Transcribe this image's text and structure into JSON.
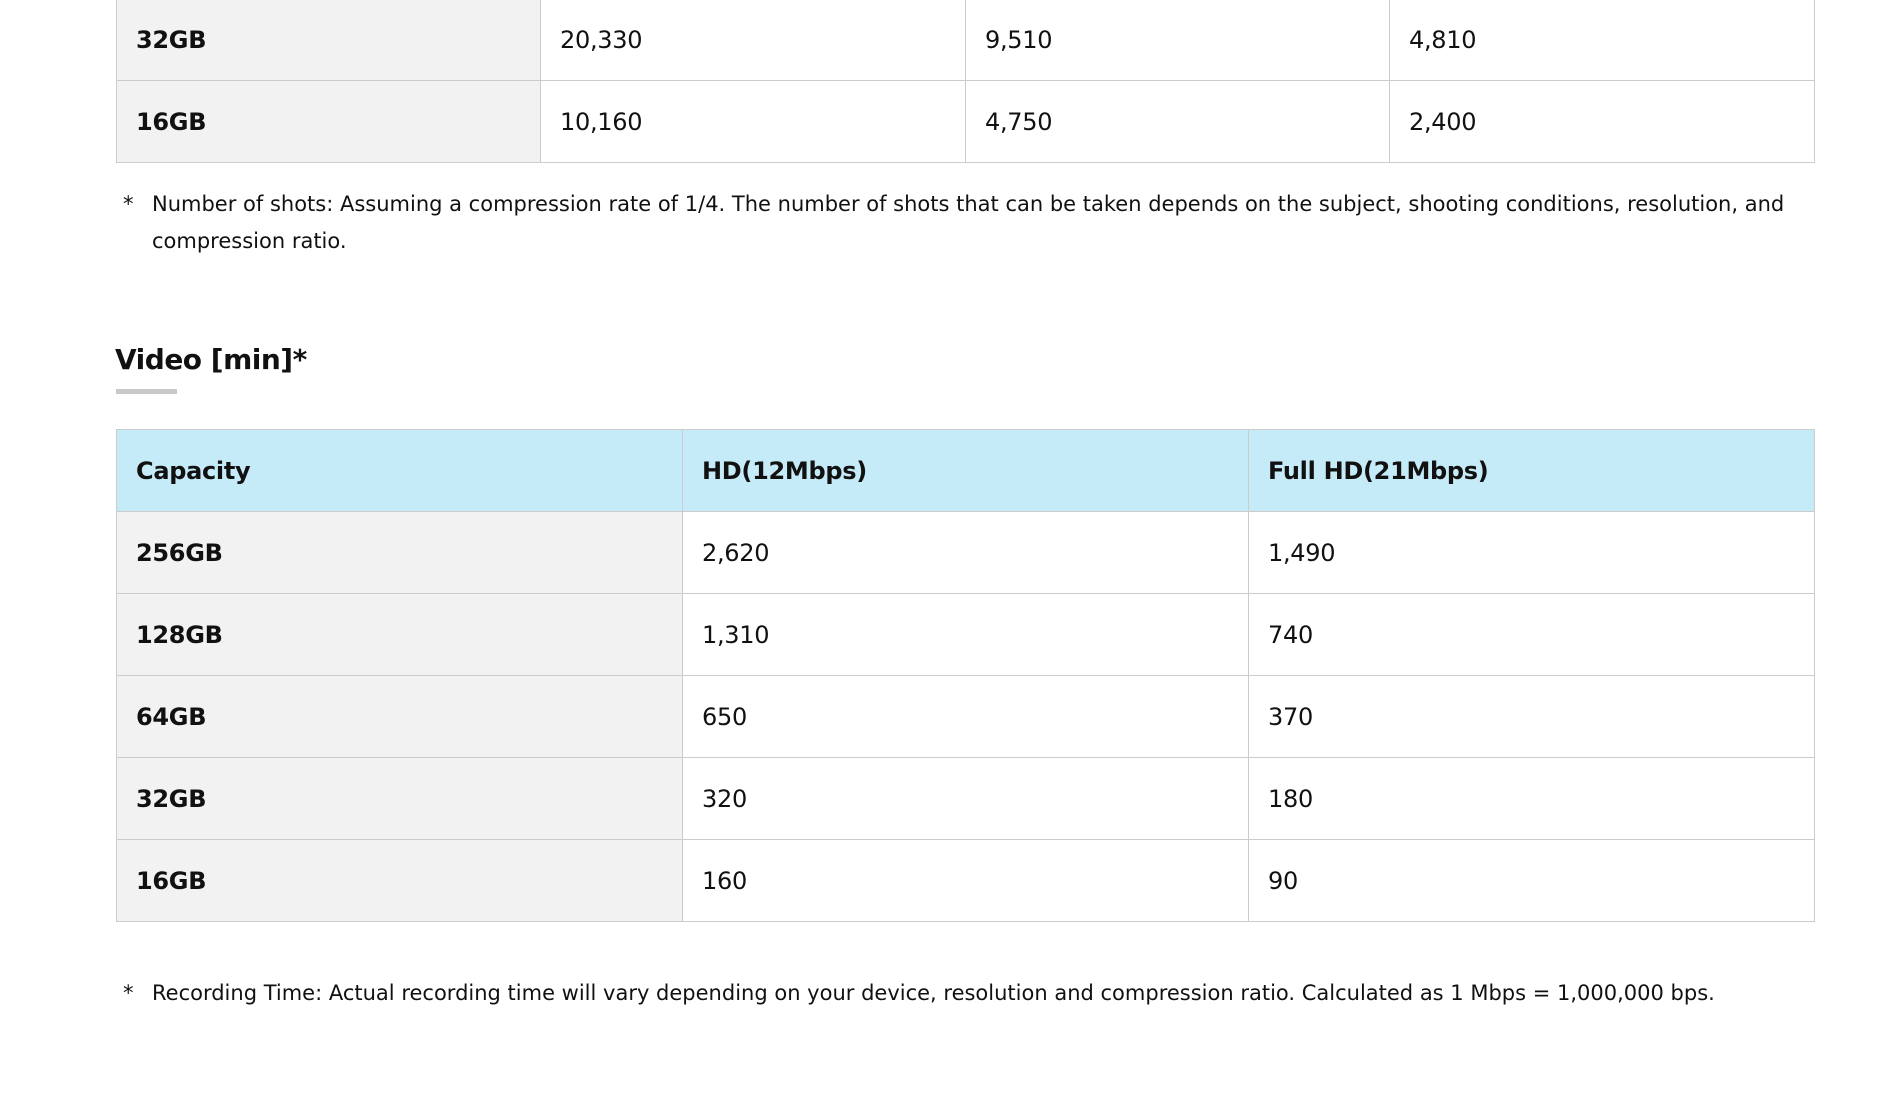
{
  "photo_table": {
    "rows": [
      {
        "capacity": "32GB",
        "c1": "20,330",
        "c2": "9,510",
        "c3": "4,810"
      },
      {
        "capacity": "16GB",
        "c1": "10,160",
        "c2": "4,750",
        "c3": "2,400"
      }
    ],
    "note_star": "*",
    "note": "Number of shots: Assuming a compression rate of 1/4. The number of shots that can be taken depends on the subject, shooting conditions, resolution, and compression ratio."
  },
  "video_section": {
    "title": "Video [min]*",
    "headers": [
      "Capacity",
      "HD(12Mbps)",
      "Full HD(21Mbps)"
    ],
    "rows": [
      {
        "capacity": "256GB",
        "hd": "2,620",
        "fullhd": "1,490"
      },
      {
        "capacity": "128GB",
        "hd": "1,310",
        "fullhd": "740"
      },
      {
        "capacity": "64GB",
        "hd": "650",
        "fullhd": "370"
      },
      {
        "capacity": "32GB",
        "hd": "320",
        "fullhd": "180"
      },
      {
        "capacity": "16GB",
        "hd": "160",
        "fullhd": "90"
      }
    ],
    "note_star": "*",
    "note": "Recording Time: Actual recording time will vary depending on your device, resolution and compression ratio. Calculated as 1 Mbps = 1,000,000 bps."
  }
}
